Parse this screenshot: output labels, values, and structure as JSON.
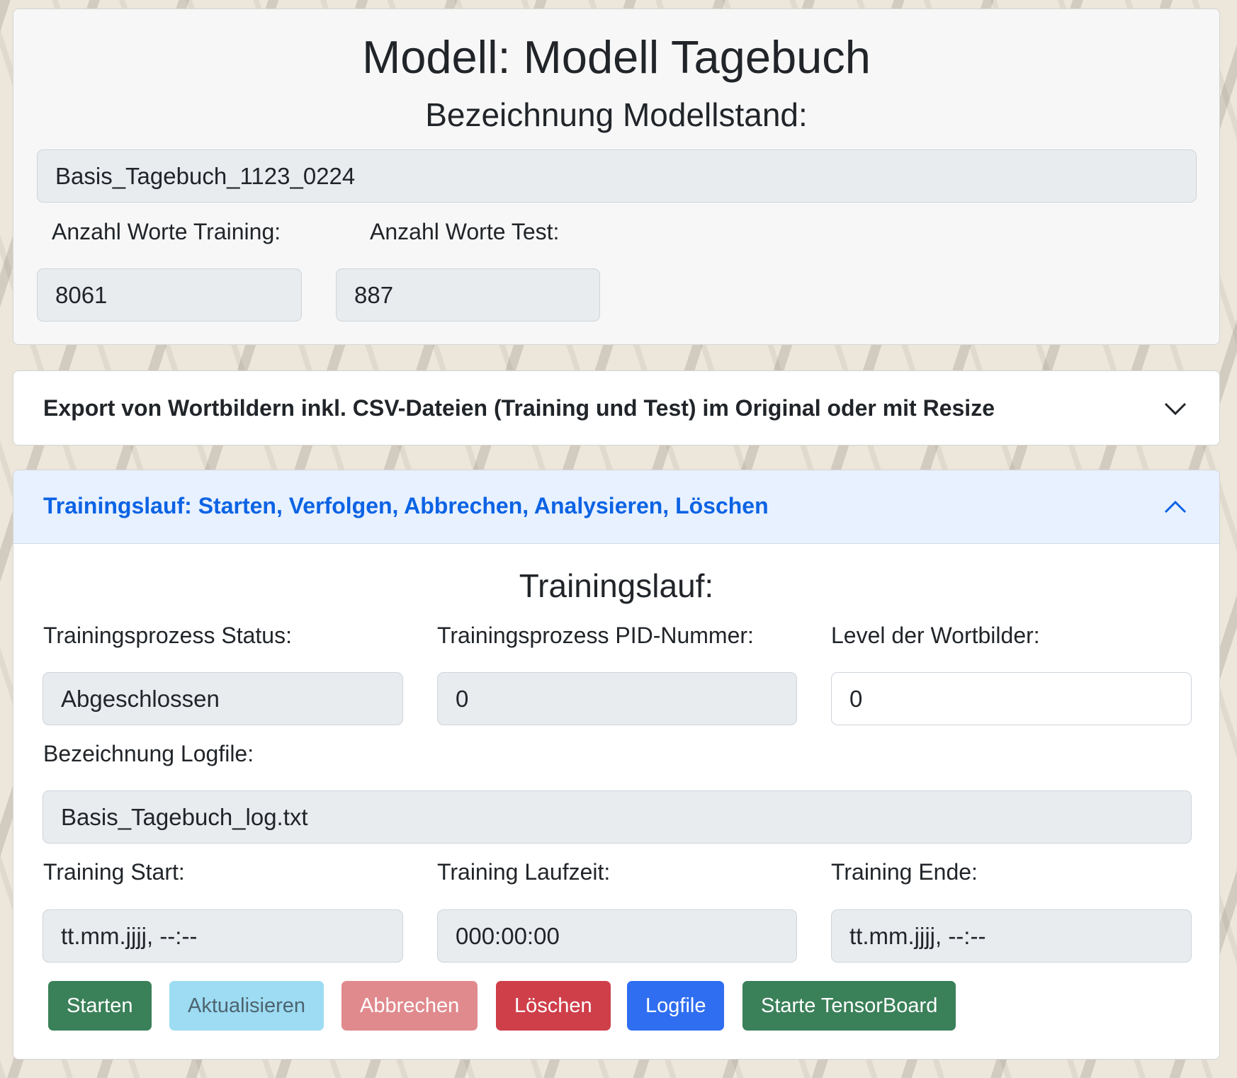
{
  "model": {
    "title": "Modell: Modell Tagebuch",
    "subtitle": "Bezeichnung Modellstand:",
    "name_value": "Basis_Tagebuch_1123_0224",
    "words_training_label": "Anzahl Worte Training:",
    "words_training_value": "8061",
    "words_test_label": "Anzahl Worte Test:",
    "words_test_value": "887"
  },
  "export_section": {
    "title": "Export von Wortbildern inkl. CSV-Dateien (Training und Test) im Original oder mit Resize",
    "icon": "chevron-down-icon"
  },
  "training_section": {
    "header": "Trainingslauf: Starten, Verfolgen, Abbrechen, Analysieren, Löschen",
    "icon": "chevron-up-icon",
    "heading": "Trainingslauf:",
    "status_label": "Trainingsprozess Status:",
    "status_value": "Abgeschlossen",
    "pid_label": "Trainingsprozess PID-Nummer:",
    "pid_value": "0",
    "level_label": "Level der Wortbilder:",
    "level_value": "0",
    "logfile_label": "Bezeichnung Logfile:",
    "logfile_value": "Basis_Tagebuch_log.txt",
    "start_label": "Training Start:",
    "start_value": "tt.mm.jjjj, --:--",
    "runtime_label": "Training Laufzeit:",
    "runtime_value": "000:00:00",
    "end_label": "Training Ende:",
    "end_value": "tt.mm.jjjj, --:--"
  },
  "buttons": {
    "start": "Starten",
    "refresh": "Aktualisieren",
    "abort": "Abbrechen",
    "delete": "Löschen",
    "logfile": "Logfile",
    "tensorboard": "Starte TensorBoard"
  },
  "colors": {
    "start": "#3a8059",
    "refresh": "#9ddcf3",
    "abort": "#e08a8e",
    "delete": "#cf3f4a",
    "logfile": "#2f6ef0",
    "tensorboard": "#3a8059",
    "accent": "#0c63e4"
  }
}
